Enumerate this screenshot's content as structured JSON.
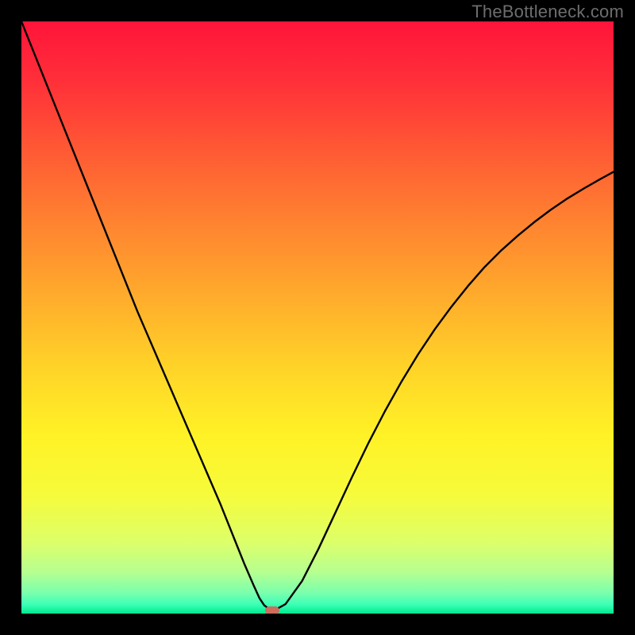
{
  "watermark": "TheBottleneck.com",
  "chart_data": {
    "type": "line",
    "title": "",
    "xlabel": "",
    "ylabel": "",
    "xlim": [
      0,
      100
    ],
    "ylim": [
      0,
      100
    ],
    "background": {
      "type": "vertical-gradient",
      "stops": [
        {
          "pos": 0.0,
          "color": "#ff143a"
        },
        {
          "pos": 0.1,
          "color": "#ff2f39"
        },
        {
          "pos": 0.22,
          "color": "#ff5a34"
        },
        {
          "pos": 0.34,
          "color": "#ff8330"
        },
        {
          "pos": 0.46,
          "color": "#ffaa2c"
        },
        {
          "pos": 0.58,
          "color": "#ffd228"
        },
        {
          "pos": 0.7,
          "color": "#fff226"
        },
        {
          "pos": 0.8,
          "color": "#f6fb3b"
        },
        {
          "pos": 0.88,
          "color": "#dcff6a"
        },
        {
          "pos": 0.93,
          "color": "#b6ff90"
        },
        {
          "pos": 0.965,
          "color": "#7affad"
        },
        {
          "pos": 0.985,
          "color": "#3bffb6"
        },
        {
          "pos": 1.0,
          "color": "#00e98f"
        }
      ]
    },
    "series": [
      {
        "name": "bottleneck-curve",
        "color": "#000000",
        "x": [
          0.0,
          2.8,
          5.6,
          8.4,
          11.2,
          14.0,
          16.8,
          19.6,
          22.4,
          25.2,
          28.0,
          30.8,
          33.6,
          36.0,
          37.6,
          39.2,
          40.2,
          41.0,
          41.8,
          42.8,
          44.6,
          47.4,
          50.2,
          53.0,
          55.8,
          58.6,
          61.4,
          64.2,
          67.0,
          69.8,
          72.6,
          75.4,
          78.2,
          81.0,
          83.8,
          86.6,
          89.4,
          92.2,
          95.0,
          97.8,
          100.0
        ],
        "y": [
          100.0,
          93.0,
          86.0,
          79.0,
          72.0,
          65.0,
          58.0,
          51.0,
          44.5,
          38.0,
          31.5,
          25.0,
          18.5,
          12.5,
          8.5,
          4.8,
          2.6,
          1.4,
          0.8,
          0.6,
          1.6,
          5.5,
          11.0,
          17.0,
          23.0,
          28.8,
          34.2,
          39.2,
          43.8,
          48.0,
          51.8,
          55.3,
          58.5,
          61.3,
          63.8,
          66.1,
          68.2,
          70.1,
          71.8,
          73.4,
          74.6
        ]
      }
    ],
    "marker": {
      "x": 42.3,
      "y": 0.5,
      "color": "#cc6d5e"
    }
  }
}
